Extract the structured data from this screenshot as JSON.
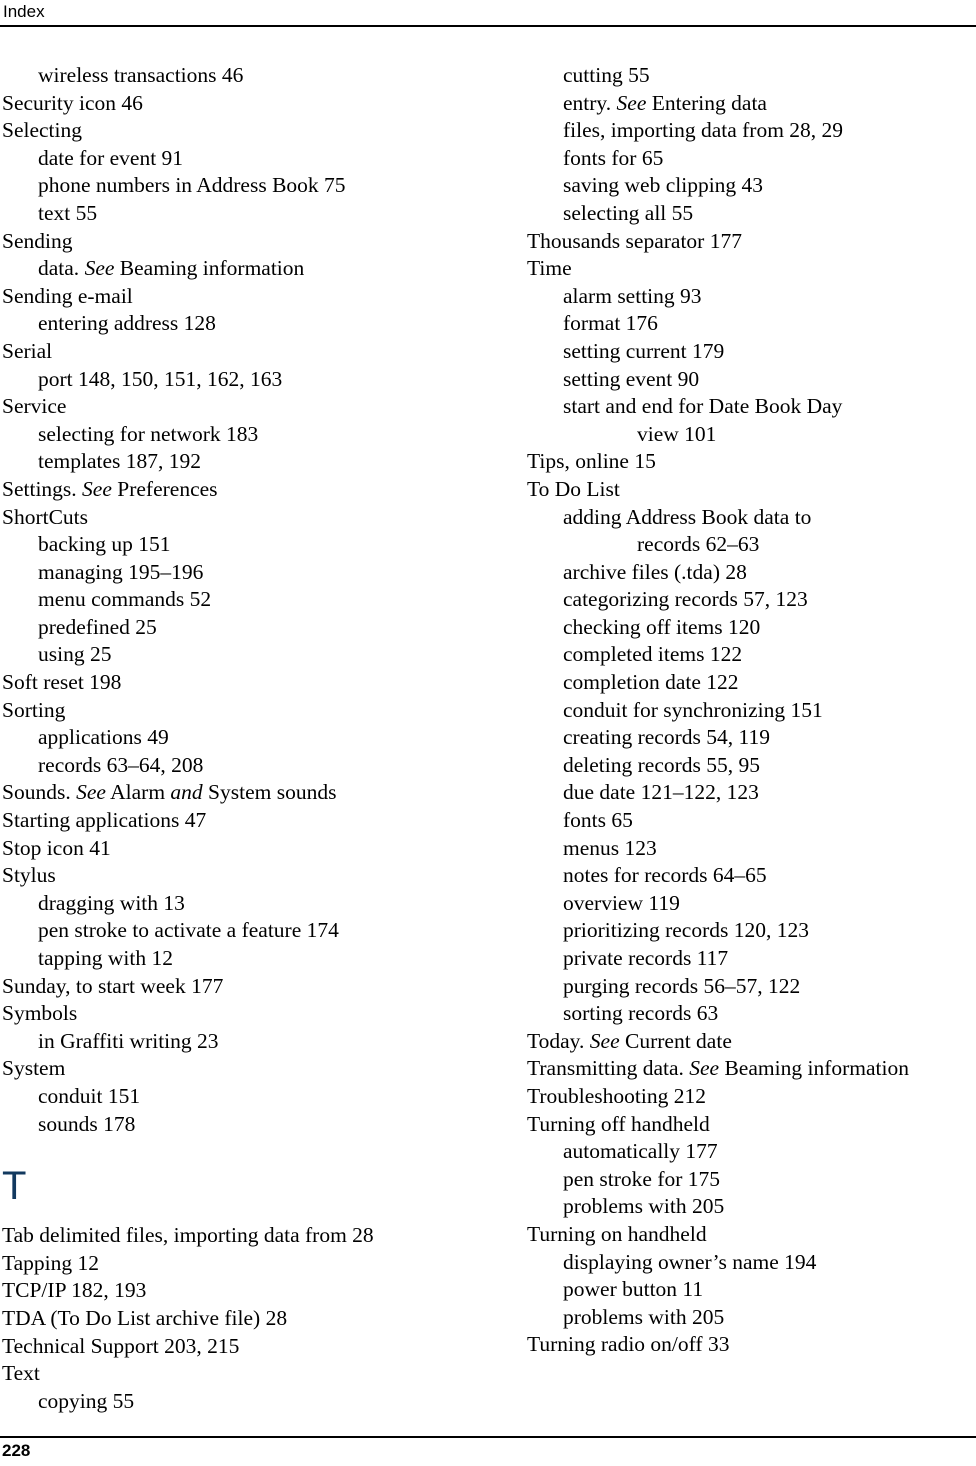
{
  "header": {
    "running_head": "Index"
  },
  "footer": {
    "page_number": "228"
  },
  "colors": {
    "section_letter": "#12395f",
    "text": "#000000",
    "rule": "#000000",
    "background": "#ffffff"
  },
  "columns": {
    "left": {
      "blocks": [
        {
          "type": "entry",
          "level": 2,
          "text": "wireless transactions  46"
        },
        {
          "type": "entry",
          "level": 1,
          "text": "Security icon  46"
        },
        {
          "type": "entry",
          "level": 1,
          "text": "Selecting"
        },
        {
          "type": "entry",
          "level": 2,
          "text": "date for event  91"
        },
        {
          "type": "entry",
          "level": 2,
          "text": "phone numbers in Address Book  75"
        },
        {
          "type": "entry",
          "level": 2,
          "text": "text  55"
        },
        {
          "type": "entry",
          "level": 1,
          "text": "Sending"
        },
        {
          "type": "see",
          "level": 2,
          "before": "data. ",
          "see": "See",
          "after": " Beaming information"
        },
        {
          "type": "entry",
          "level": 1,
          "text": "Sending e-mail"
        },
        {
          "type": "entry",
          "level": 2,
          "text": "entering address  128"
        },
        {
          "type": "entry",
          "level": 1,
          "text": "Serial"
        },
        {
          "type": "entry",
          "level": 2,
          "text": "port  148, 150, 151, 162, 163"
        },
        {
          "type": "entry",
          "level": 1,
          "text": "Service"
        },
        {
          "type": "entry",
          "level": 2,
          "text": "selecting for network  183"
        },
        {
          "type": "entry",
          "level": 2,
          "text": "templates  187, 192"
        },
        {
          "type": "see",
          "level": 1,
          "before": "Settings. ",
          "see": "See",
          "after": " Preferences"
        },
        {
          "type": "entry",
          "level": 1,
          "text": "ShortCuts"
        },
        {
          "type": "entry",
          "level": 2,
          "text": "backing up  151"
        },
        {
          "type": "entry",
          "level": 2,
          "text": "managing  195–196"
        },
        {
          "type": "entry",
          "level": 2,
          "text": "menu commands  52"
        },
        {
          "type": "entry",
          "level": 2,
          "text": "predefined  25"
        },
        {
          "type": "entry",
          "level": 2,
          "text": "using  25"
        },
        {
          "type": "entry",
          "level": 1,
          "text": "Soft reset  198"
        },
        {
          "type": "entry",
          "level": 1,
          "text": "Sorting"
        },
        {
          "type": "entry",
          "level": 2,
          "text": "applications  49"
        },
        {
          "type": "entry",
          "level": 2,
          "text": "records  63–64, 208"
        },
        {
          "type": "see2",
          "level": 1,
          "before": "Sounds. ",
          "see": "See",
          "mid": " Alarm ",
          "and": "and",
          "after": " System sounds"
        },
        {
          "type": "entry",
          "level": 1,
          "text": "Starting applications  47"
        },
        {
          "type": "entry",
          "level": 1,
          "text": "Stop icon  41"
        },
        {
          "type": "entry",
          "level": 1,
          "text": "Stylus"
        },
        {
          "type": "entry",
          "level": 2,
          "text": "dragging with  13"
        },
        {
          "type": "entry",
          "level": 2,
          "text": "pen stroke to activate a feature  174"
        },
        {
          "type": "entry",
          "level": 2,
          "text": "tapping with  12"
        },
        {
          "type": "entry",
          "level": 1,
          "text": "Sunday, to start week  177"
        },
        {
          "type": "entry",
          "level": 1,
          "text": "Symbols"
        },
        {
          "type": "entry",
          "level": 2,
          "text": "in Graffiti writing  23"
        },
        {
          "type": "entry",
          "level": 1,
          "text": "System"
        },
        {
          "type": "entry",
          "level": 2,
          "text": "conduit  151"
        },
        {
          "type": "entry",
          "level": 2,
          "text": "sounds  178"
        },
        {
          "type": "section",
          "letter": "T"
        },
        {
          "type": "entry",
          "level": 1,
          "text": "Tab delimited files, importing data from  28"
        },
        {
          "type": "entry",
          "level": 1,
          "text": "Tapping  12"
        },
        {
          "type": "entry",
          "level": 1,
          "text": "TCP/IP  182, 193"
        },
        {
          "type": "entry",
          "level": 1,
          "text": "TDA (To Do List archive file)  28"
        },
        {
          "type": "entry",
          "level": 1,
          "text": "Technical Support  203, 215"
        },
        {
          "type": "entry",
          "level": 1,
          "text": "Text"
        },
        {
          "type": "entry",
          "level": 2,
          "text": "copying  55"
        }
      ]
    },
    "right": {
      "blocks": [
        {
          "type": "entry",
          "level": 2,
          "text": "cutting  55"
        },
        {
          "type": "see",
          "level": 2,
          "before": "entry. ",
          "see": "See",
          "after": " Entering data"
        },
        {
          "type": "entry",
          "level": 2,
          "text": "files, importing data from  28, 29"
        },
        {
          "type": "entry",
          "level": 2,
          "text": "fonts for  65"
        },
        {
          "type": "entry",
          "level": 2,
          "text": "saving web clipping  43"
        },
        {
          "type": "entry",
          "level": 2,
          "text": "selecting all  55"
        },
        {
          "type": "entry",
          "level": 1,
          "text": "Thousands separator  177"
        },
        {
          "type": "entry",
          "level": 1,
          "text": "Time"
        },
        {
          "type": "entry",
          "level": 2,
          "text": "alarm setting  93"
        },
        {
          "type": "entry",
          "level": 2,
          "text": "format  176"
        },
        {
          "type": "entry",
          "level": 2,
          "text": "setting current  179"
        },
        {
          "type": "entry",
          "level": 2,
          "text": "setting event  90"
        },
        {
          "type": "cont",
          "level": 2,
          "text": "start and end for Date Book Day",
          "continuation": "view  101"
        },
        {
          "type": "entry",
          "level": 1,
          "text": "Tips, online  15"
        },
        {
          "type": "entry",
          "level": 1,
          "text": "To Do List"
        },
        {
          "type": "cont",
          "level": 2,
          "text": "adding Address Book data to",
          "continuation": "records  62–63"
        },
        {
          "type": "entry",
          "level": 2,
          "text": "archive files (.tda)  28"
        },
        {
          "type": "entry",
          "level": 2,
          "text": "categorizing records  57, 123"
        },
        {
          "type": "entry",
          "level": 2,
          "text": "checking off items  120"
        },
        {
          "type": "entry",
          "level": 2,
          "text": "completed items  122"
        },
        {
          "type": "entry",
          "level": 2,
          "text": "completion date  122"
        },
        {
          "type": "entry",
          "level": 2,
          "text": "conduit for synchronizing  151"
        },
        {
          "type": "entry",
          "level": 2,
          "text": "creating records  54, 119"
        },
        {
          "type": "entry",
          "level": 2,
          "text": "deleting records  55, 95"
        },
        {
          "type": "entry",
          "level": 2,
          "text": "due date  121–122, 123"
        },
        {
          "type": "entry",
          "level": 2,
          "text": "fonts  65"
        },
        {
          "type": "entry",
          "level": 2,
          "text": "menus  123"
        },
        {
          "type": "entry",
          "level": 2,
          "text": "notes for records  64–65"
        },
        {
          "type": "entry",
          "level": 2,
          "text": "overview  119"
        },
        {
          "type": "entry",
          "level": 2,
          "text": "prioritizing records  120, 123"
        },
        {
          "type": "entry",
          "level": 2,
          "text": "private records  117"
        },
        {
          "type": "entry",
          "level": 2,
          "text": "purging records  56–57, 122"
        },
        {
          "type": "entry",
          "level": 2,
          "text": "sorting records  63"
        },
        {
          "type": "see",
          "level": 1,
          "before": "Today. ",
          "see": "See",
          "after": " Current date"
        },
        {
          "type": "see",
          "level": 1,
          "before": "Transmitting data. ",
          "see": "See",
          "after": " Beaming information"
        },
        {
          "type": "entry",
          "level": 1,
          "text": "Troubleshooting  212"
        },
        {
          "type": "entry",
          "level": 1,
          "text": "Turning off handheld"
        },
        {
          "type": "entry",
          "level": 2,
          "text": "automatically  177"
        },
        {
          "type": "entry",
          "level": 2,
          "text": "pen stroke for  175"
        },
        {
          "type": "entry",
          "level": 2,
          "text": "problems with  205"
        },
        {
          "type": "entry",
          "level": 1,
          "text": "Turning on handheld"
        },
        {
          "type": "entry",
          "level": 2,
          "text": "displaying owner’s name  194"
        },
        {
          "type": "entry",
          "level": 2,
          "text": "power button  11"
        },
        {
          "type": "entry",
          "level": 2,
          "text": "problems with  205"
        },
        {
          "type": "entry",
          "level": 1,
          "text": "Turning radio on/off  33"
        }
      ]
    }
  }
}
